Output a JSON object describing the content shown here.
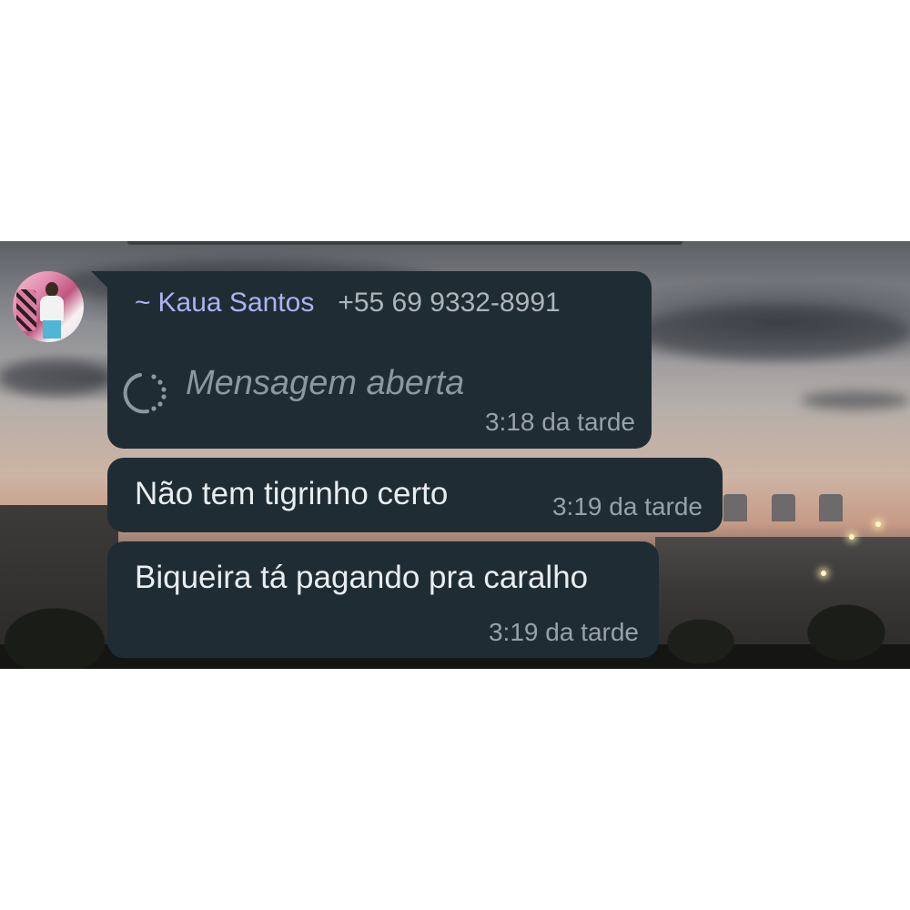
{
  "conversation": {
    "messages": [
      {
        "sender_prefix": "~",
        "sender_name": "Kaua Santos",
        "sender_phone": "+55 69 9332-8991",
        "text": "Mensagem aberta",
        "time": "3:18 da tarde",
        "icon": "view-once-opened-icon"
      },
      {
        "text": "Não tem tigrinho certo",
        "time": "3:19 da tarde"
      },
      {
        "text": "Biqueira tá pagando pra caralho",
        "time": "3:19 da tarde"
      }
    ]
  },
  "colors": {
    "bubble_bg": "#1f2c34",
    "sender_name": "#aab3f2",
    "message_text": "#e9edef",
    "timestamp": "#98a2a8",
    "placeholder_text": "#8d979e",
    "page_background": "#ffffff"
  }
}
